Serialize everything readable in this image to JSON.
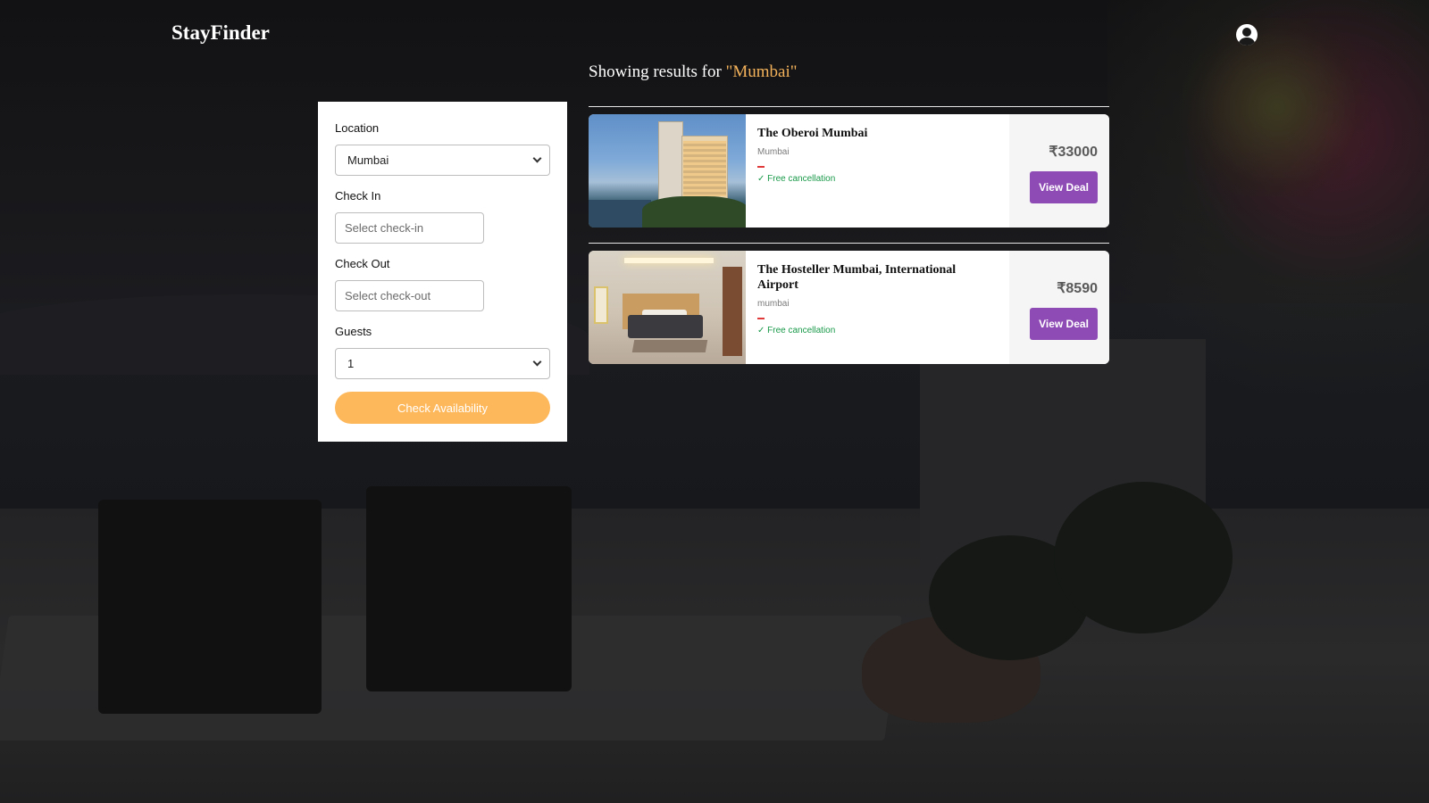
{
  "header": {
    "brand": "StayFinder",
    "user_icon": "user-circle-icon"
  },
  "results": {
    "prefix": "Showing results for ",
    "query": "\"Mumbai\""
  },
  "filters": {
    "location_label": "Location",
    "location_value": "Mumbai",
    "checkin_label": "Check In",
    "checkin_placeholder": "Select check-in",
    "checkout_label": "Check Out",
    "checkout_placeholder": "Select check-out",
    "guests_label": "Guests",
    "guests_value": "1",
    "submit_label": "Check Availability"
  },
  "hotels": [
    {
      "name": "The Oberoi Mumbai",
      "city": "Mumbai",
      "cancellation": "✓ Free cancellation",
      "price": "₹33000",
      "cta": "View Deal"
    },
    {
      "name": "The Hosteller Mumbai, International Airport",
      "city": "mumbai",
      "cancellation": "✓ Free cancellation",
      "price": "₹8590",
      "cta": "View Deal"
    }
  ],
  "colors": {
    "accent_orange": "#fdb85c",
    "query_highlight": "#f4b35a",
    "deal_purple": "#8e4bb5",
    "free_cancel_green": "#1a9a4a"
  }
}
